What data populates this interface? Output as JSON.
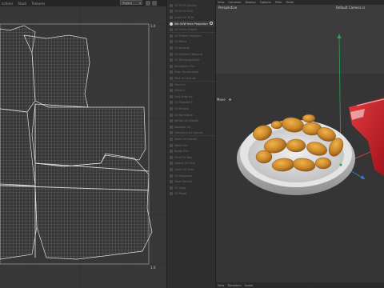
{
  "uv_editor": {
    "menu": [
      "ections",
      "Stack",
      "Textures"
    ],
    "dropdown_value": "Project",
    "tick_top_right": "1.0",
    "tick_bottom_right": "1.0"
  },
  "tools": {
    "items": [
      "UV Fit To Canvas",
      "Fit UV To Grid",
      "Scale UV To Fit",
      "Set UVW from Projection",
      "UV Ortho Project",
      "UV Flatten Polygons",
      "UV Relax",
      "UV Unwrap",
      "UV Optimal Mapping",
      "UV Rectangularize",
      "Straighten UVs",
      "Align Horizontally",
      "Pack UV Islands",
      "Mirror U",
      "Mirror V",
      "Grid Snap UV",
      "UV Transform",
      "UV Terrace",
      "UV Normalize",
      "Rotate UV Islands",
      "Equalize UV",
      "Distribute UV Islands",
      "Stack UV Islands",
      "Weld UVs",
      "Break UVs",
      "Fit UV To Box",
      "Layout UV Grid",
      "Clean UV Sets",
      "UV Sequence",
      "Texel Density",
      "UV Copy",
      "UV Paste"
    ],
    "active_index": 3
  },
  "viewport": {
    "menu": [
      "View",
      "Cameras",
      "Display",
      "Options",
      "Filter",
      "Panel"
    ],
    "label": "Perspective",
    "camera": "Default Camera",
    "camera_icon": "camera-icon",
    "move_label": "Move",
    "move_icon": "move-icon",
    "status": [
      "View",
      "Transform",
      "Scene"
    ]
  },
  "colors": {
    "active_tool_bg": "#3a3a3a",
    "axis_y": "#2fa05a",
    "axis_x": "#d84a4a",
    "axis_z": "#3a7fe0",
    "package_red": "#c8202a"
  }
}
